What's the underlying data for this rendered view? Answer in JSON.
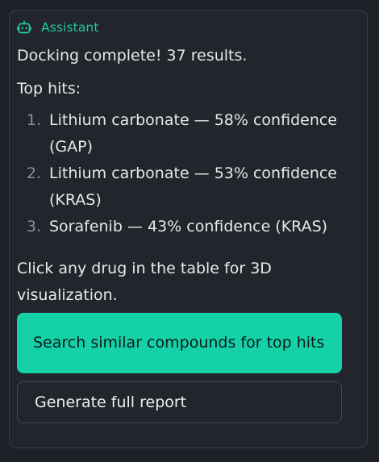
{
  "header": {
    "icon": "bot-icon",
    "label": "Assistant",
    "accent_color": "#25c9a1"
  },
  "message": {
    "intro": "Docking complete! 37 results.",
    "top_hits_heading": "Top hits:",
    "top_hits": [
      {
        "number": "1.",
        "text": "Lithium carbonate — 58% confidence (GAP)"
      },
      {
        "number": "2.",
        "text": "Lithium carbonate — 53% confidence (KRAS)"
      },
      {
        "number": "3.",
        "text": "Sorafenib — 43% confidence (KRAS)"
      }
    ],
    "outro": "Click any drug in the table for 3D visualization."
  },
  "actions": {
    "primary_label": "Search similar compounds for top hits",
    "primary_color": "#14d1a8",
    "secondary_label": "Generate full report"
  }
}
